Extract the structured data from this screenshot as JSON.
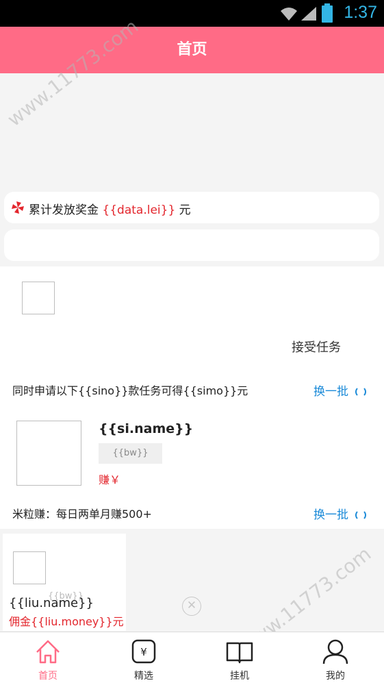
{
  "status_bar": {
    "time": "1:37"
  },
  "header": {
    "title": "首页"
  },
  "reward": {
    "prefix": "累计发放奖金 ",
    "value": "{{data.lei}}",
    "suffix": " 元"
  },
  "task": {
    "accept_label": "接受任务",
    "description": "同时申请以下{{sino}}款任务可得{{simo}}元",
    "swap_label": "换一批",
    "product": {
      "name": "{{si.name}}",
      "badge": "{{bw}}",
      "earn": "赚￥"
    },
    "mili_text": "米粒赚：每日两单月赚500+"
  },
  "list_item": {
    "bw": "{{bw}}",
    "name": "{{liu.name}}",
    "money": "佣金{{liu.money}}元"
  },
  "tabs": [
    {
      "label": "首页",
      "icon": "home-icon",
      "active": true
    },
    {
      "label": "精选",
      "icon": "yen-icon",
      "active": false
    },
    {
      "label": "挂机",
      "icon": "book-icon",
      "active": false
    },
    {
      "label": "我的",
      "icon": "user-icon",
      "active": false
    }
  ],
  "watermark": "www.11773.com",
  "colors": {
    "header": "#ff6b86",
    "accent_red": "#e3262d",
    "link_blue": "#1a8ad8",
    "status_blue": "#33b5e5"
  }
}
